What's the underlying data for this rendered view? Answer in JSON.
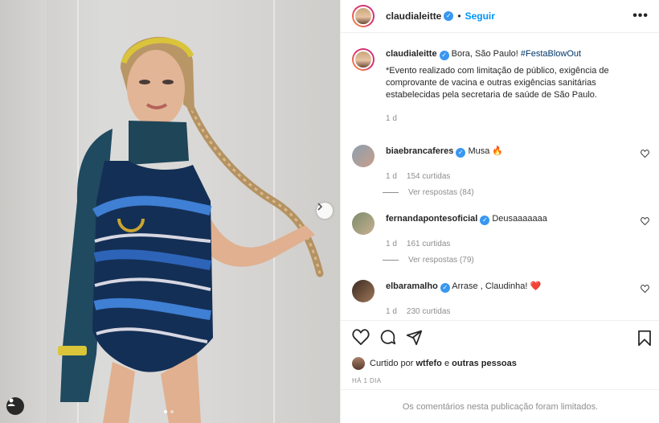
{
  "post": {
    "username": "claudialeitte",
    "follow_label": "Seguir",
    "dot": "•",
    "more_label": "•••",
    "caption_text": "Bora, São Paulo!",
    "caption_hashtag": "#FestaBlowOut",
    "caption_note": "*Evento realizado com limitação de público, exigência de comprovante de vacina e outras exigências sanitárias estabelecidas pela secretaria de saúde de São Paulo.",
    "caption_time": "1 d"
  },
  "comments": [
    {
      "username": "biaebrancaferes",
      "text": "Musa 🔥",
      "time": "1 d",
      "likes": "154 curtidas",
      "replies": "Ver respostas (84)"
    },
    {
      "username": "fernandapontesoficial",
      "text": "Deusaaaaaaa",
      "time": "1 d",
      "likes": "161 curtidas",
      "replies": "Ver respostas (79)"
    },
    {
      "username": "elbaramalho",
      "text": "Arrase , Claudinha! ❤️",
      "time": "1 d",
      "likes": "230 curtidas"
    }
  ],
  "likes_line": {
    "prefix": "Curtido por",
    "user": "wtfefo",
    "conj": "e",
    "others": "outras pessoas"
  },
  "time_ago": "HÁ 1 DIA",
  "comments_limited": "Os comentários nesta publicação foram limitados.",
  "icons": {
    "verified": "✓",
    "heart": "heart-icon",
    "comment": "comment-icon",
    "share": "share-icon",
    "bookmark": "bookmark-icon"
  },
  "colors": {
    "link_blue": "#0095f6",
    "verified_blue": "#3897f0",
    "muted": "#8e8e8e",
    "hashtag": "#00376b"
  },
  "carousel": {
    "slides": 2,
    "active": 1
  }
}
